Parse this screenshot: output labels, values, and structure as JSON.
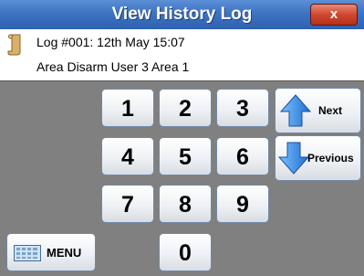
{
  "window": {
    "title": "View History Log",
    "close_label": "x"
  },
  "log": {
    "line1": "Log #001: 12th May 15:07",
    "line2": "Area Disarm  User 3  Area 1"
  },
  "keypad": {
    "k1": "1",
    "k2": "2",
    "k3": "3",
    "k4": "4",
    "k5": "5",
    "k6": "6",
    "k7": "7",
    "k8": "8",
    "k9": "9",
    "k0": "0"
  },
  "nav": {
    "next_label": "Next",
    "previous_label": "Previous"
  },
  "menu": {
    "label": "MENU"
  },
  "colors": {
    "title_bar": "#3d73c2",
    "close": "#d0472f",
    "arrow": "#2b7fe0",
    "background": "#808080"
  }
}
